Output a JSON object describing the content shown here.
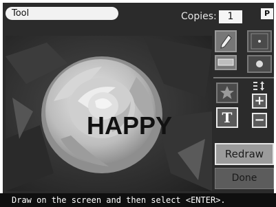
{
  "header": {
    "tool_label": "Tool",
    "copies_label": "Copies:",
    "copies_value": "1",
    "print_badge": "P"
  },
  "canvas": {
    "stamp_text": "HAPPY"
  },
  "tools": {
    "text_tool_glyph": "T",
    "plus_glyph": "+",
    "minus_glyph": "−"
  },
  "actions": {
    "redraw_label": "Redraw",
    "done_label": "Done"
  },
  "status": {
    "message": "Draw on the screen and then select <ENTER>."
  },
  "icons": [
    "pencil-icon",
    "eraser-icon",
    "small-brush-icon",
    "large-brush-icon",
    "star-stamp-icon",
    "text-tool-icon",
    "size-adjust-icon"
  ]
}
